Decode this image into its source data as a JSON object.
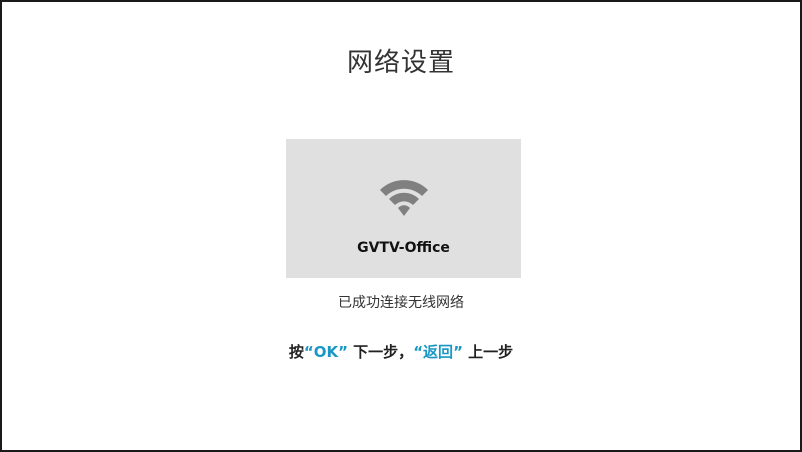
{
  "page": {
    "title": "网络设置"
  },
  "network": {
    "icon": "wifi-icon",
    "name": "GVTV-Office",
    "status": "已成功连接无线网络"
  },
  "hint": {
    "prefix": "按",
    "open_quote_1": "“",
    "ok_key": "OK",
    "close_quote_1": "”",
    "next_action": " 下一步，",
    "open_quote_2": "“",
    "back_key": "返回",
    "close_quote_2": "”",
    "prev_action": " 上一步"
  },
  "colors": {
    "accent": "#1a97c4",
    "card_background": "#e0e0e0",
    "icon": "#808080"
  }
}
